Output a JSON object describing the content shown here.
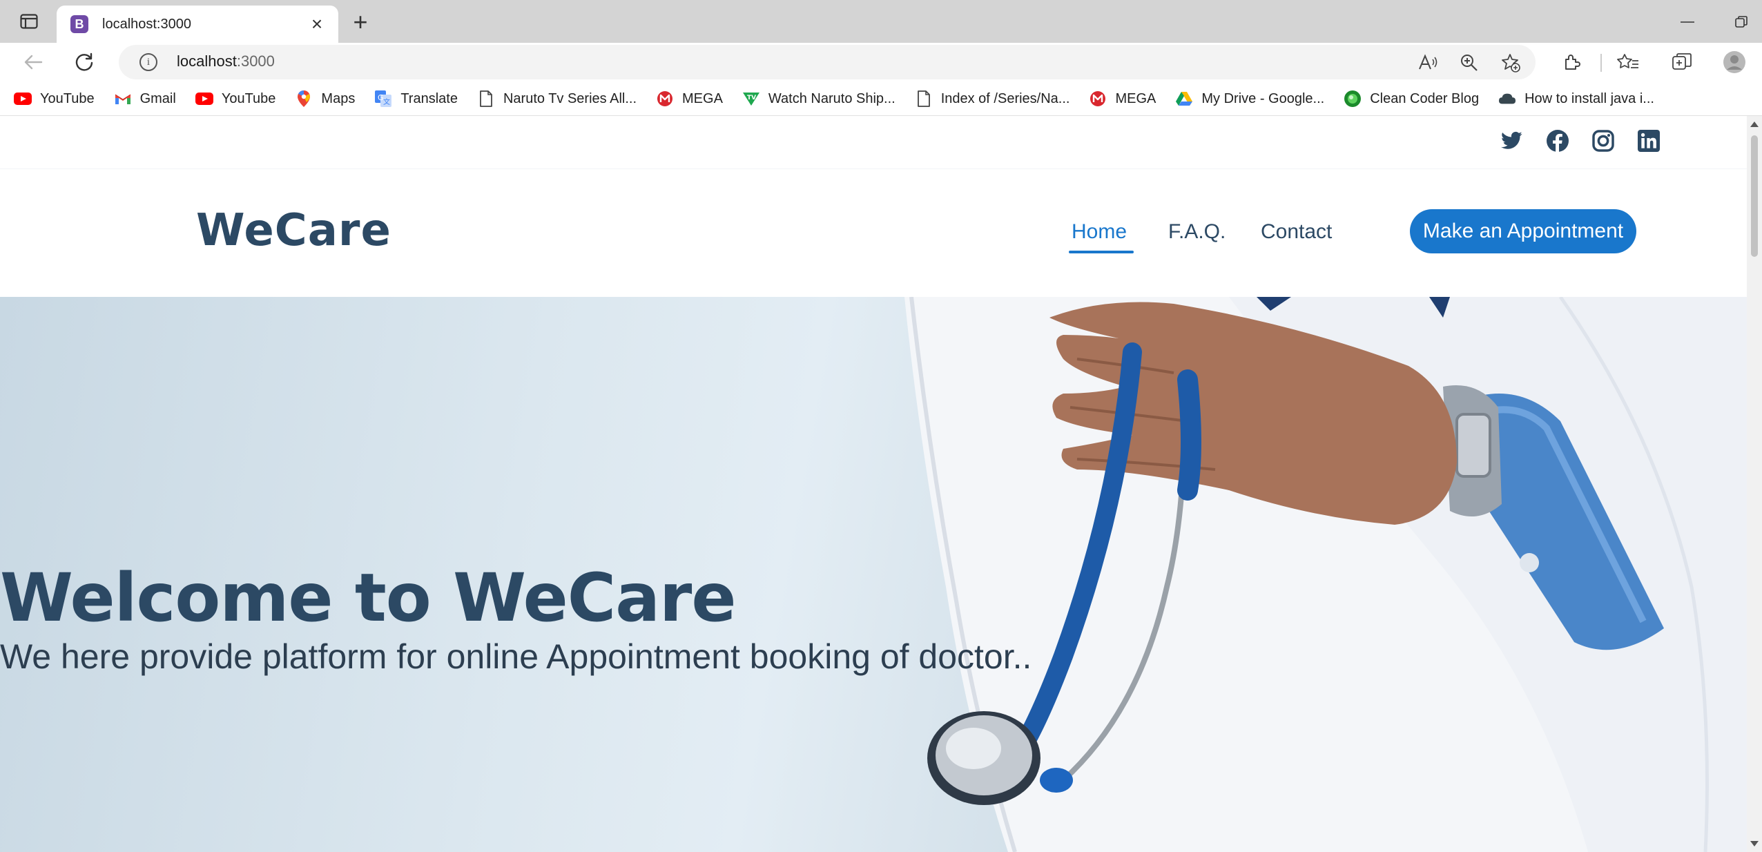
{
  "browser": {
    "tab": {
      "favicon_letter": "B",
      "title": "localhost:3000",
      "close": "×"
    },
    "new_tab": "+",
    "address": {
      "host": "localhost",
      "port": ":3000"
    },
    "bookmarks": [
      {
        "label": "YouTube",
        "icon": "youtube-icon"
      },
      {
        "label": "Gmail",
        "icon": "gmail-icon"
      },
      {
        "label": "YouTube",
        "icon": "youtube-icon"
      },
      {
        "label": "Maps",
        "icon": "maps-icon"
      },
      {
        "label": "Translate",
        "icon": "translate-icon"
      },
      {
        "label": "Naruto Tv Series All...",
        "icon": "page-icon"
      },
      {
        "label": "MEGA",
        "icon": "mega-icon"
      },
      {
        "label": "Watch Naruto Ship...",
        "icon": "tv-icon"
      },
      {
        "label": "Index of /Series/Na...",
        "icon": "page-icon"
      },
      {
        "label": "MEGA",
        "icon": "mega-icon"
      },
      {
        "label": "My Drive - Google...",
        "icon": "drive-icon"
      },
      {
        "label": "Clean Coder Blog",
        "icon": "globe-icon"
      },
      {
        "label": "How to install java i...",
        "icon": "cloud-icon"
      }
    ]
  },
  "site": {
    "brand": "WeCare",
    "nav": {
      "home": "Home",
      "faq": "F.A.Q.",
      "contact": "Contact"
    },
    "cta": "Make an Appointment",
    "hero": {
      "title": "Welcome to WeCare",
      "subtitle": "We here provide platform for online Appointment booking of doctor.."
    },
    "social": [
      "twitter-icon",
      "facebook-icon",
      "instagram-icon",
      "linkedin-icon"
    ]
  },
  "colors": {
    "brand": "#2c4964",
    "accent": "#1977cc"
  }
}
